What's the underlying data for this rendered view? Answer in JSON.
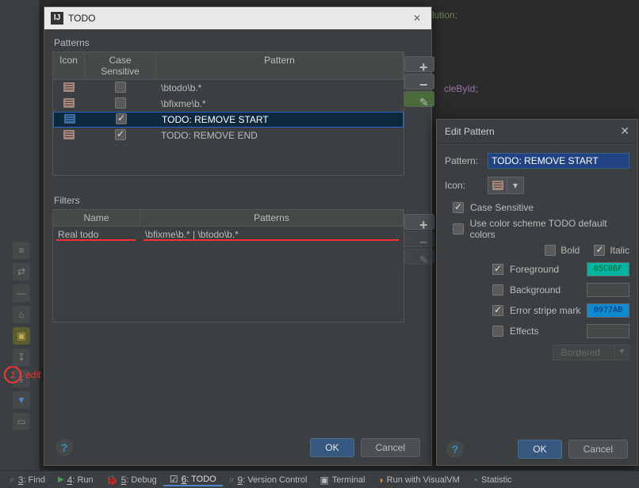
{
  "bg": {
    "line1": "lution;",
    "line2": "cleById;"
  },
  "todo_dialog": {
    "title": "TODO",
    "patterns_label": "Patterns",
    "filters_label": "Filters",
    "headers": {
      "icon": "Icon",
      "case_sensitive": "Case Sensitive",
      "pattern": "Pattern"
    },
    "pattern_rows": [
      {
        "pattern": "\\btodo\\b.*",
        "case_sensitive": false,
        "selected": false,
        "icon": "note"
      },
      {
        "pattern": "\\bfixme\\b.*",
        "case_sensitive": false,
        "selected": false,
        "icon": "note"
      },
      {
        "pattern": "TODO: REMOVE START",
        "case_sensitive": true,
        "selected": true,
        "icon": "note-blue"
      },
      {
        "pattern": "TODO: REMOVE END",
        "case_sensitive": true,
        "selected": false,
        "icon": "note"
      }
    ],
    "filter_headers": {
      "name": "Name",
      "patterns": "Patterns"
    },
    "filter_rows": [
      {
        "name": "Real todo",
        "patterns": "\\bfixme\\b.* | \\btodo\\b.*"
      }
    ],
    "ok": "OK",
    "cancel": "Cancel"
  },
  "edit_pattern": {
    "title": "Edit Pattern",
    "pattern_label": "Pattern:",
    "pattern_value": "TODO: REMOVE START",
    "icon_label": "Icon:",
    "case_sensitive_label": "Case Sensitive",
    "case_sensitive": true,
    "use_default_colors_label": "Use color scheme TODO default colors",
    "use_default_colors": false,
    "bold_label": "Bold",
    "bold": false,
    "italic_label": "Italic",
    "italic": true,
    "foreground_label": "Foreground",
    "foreground_on": true,
    "foreground_value": "05C0BF",
    "background_label": "Background",
    "background_on": false,
    "error_stripe_label": "Error stripe mark",
    "error_stripe_on": true,
    "error_stripe_value": "0977AB",
    "effects_label": "Effects",
    "effects_on": false,
    "effects_type": "Bordered",
    "ok": "OK",
    "cancel": "Cancel"
  },
  "annotation": {
    "edit": "edit",
    "num": "1"
  },
  "status_items": [
    {
      "num": "3",
      "label": "Find"
    },
    {
      "num": "4",
      "label": "Run",
      "run": true
    },
    {
      "num": "5",
      "label": "Debug",
      "bug": true
    },
    {
      "num": "6",
      "label": "TODO",
      "active": true,
      "todoico": true
    },
    {
      "num": "9",
      "label": "Version Control"
    },
    {
      "num": "",
      "label": "Terminal",
      "term": true
    },
    {
      "num": "",
      "label": "Run with VisualVM",
      "vvm": true
    },
    {
      "num": "",
      "label": "Statistic",
      "stat": true
    }
  ]
}
